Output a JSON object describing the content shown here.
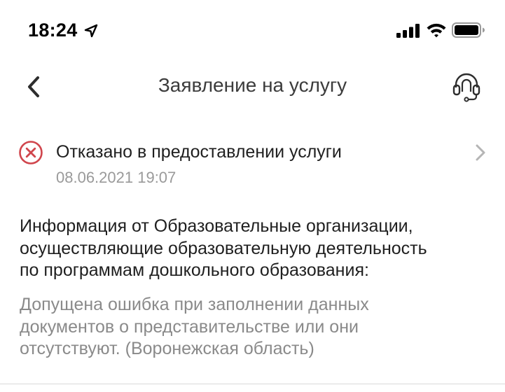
{
  "status_bar": {
    "time": "18:24",
    "icons": [
      "location-arrow-icon",
      "cellular-signal-icon",
      "wifi-icon",
      "battery-icon"
    ]
  },
  "nav": {
    "title": "Заявление на услугу",
    "back_icon": "chevron-left-icon",
    "support_icon": "headset-support-icon"
  },
  "status": {
    "title": "Отказано в предоставлении услуги",
    "date": "08.06.2021 19:07",
    "icon": "refused-cross-circle-icon",
    "icon_color": "#d0454c"
  },
  "info": {
    "heading_lines": [
      "Информация от Образовательные организации,",
      "осуществляющие образовательную деятельность",
      "по программам дошкольного образования:"
    ],
    "text_lines": [
      "Допущена ошибка при заполнении данных",
      "документов о представительстве или они",
      "отсутствуют. (Воронежская область)"
    ]
  },
  "colors": {
    "primary_text": "#1f1f1f",
    "secondary_text": "#8a8a8a",
    "error": "#d0454c"
  }
}
